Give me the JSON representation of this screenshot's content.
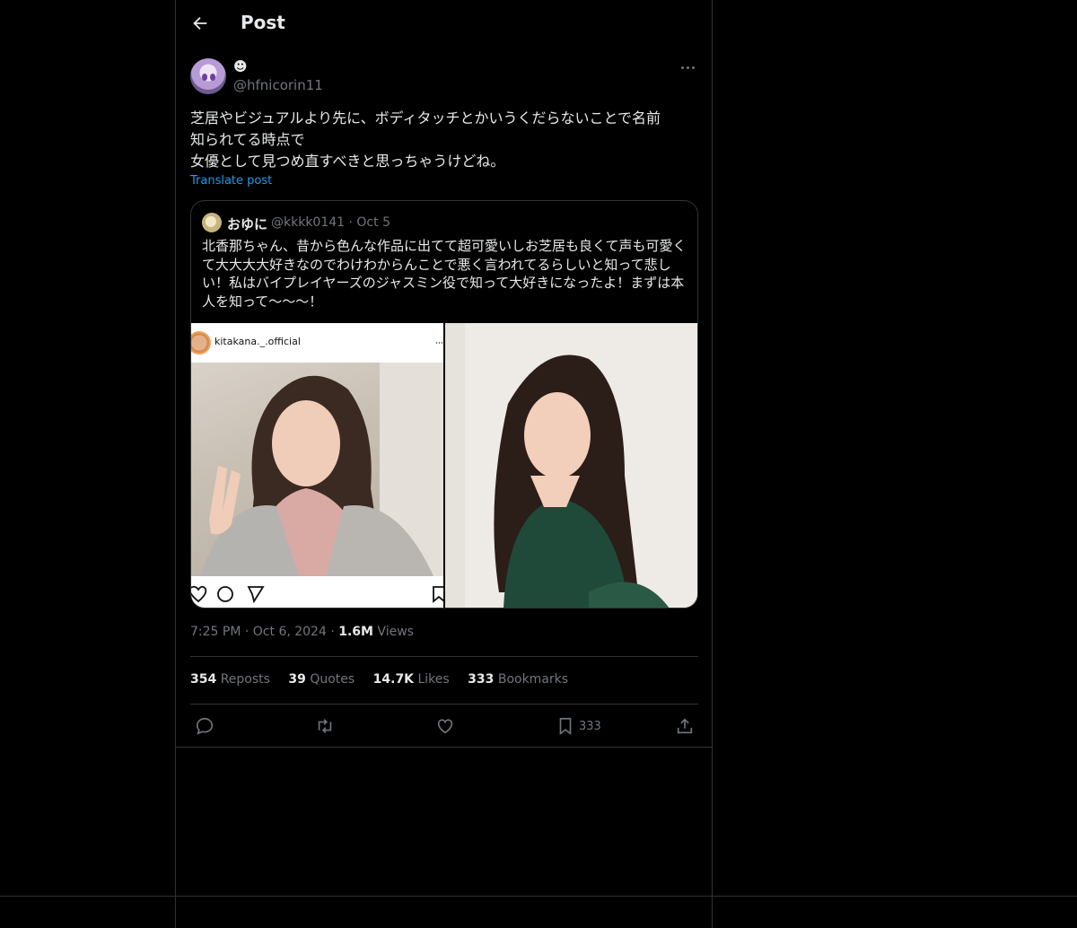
{
  "header": {
    "title": "Post"
  },
  "post": {
    "display_name": "☻",
    "handle": "@hfnicorin11",
    "text_lines": [
      "芝居やビジュアルより先に、ボディタッチとかいうくだらないことで名前",
      "知られてる時点で",
      "女優として見つめ直すべきと思っちゃうけどね。"
    ],
    "translate_label": "Translate post",
    "time": "7:25 PM",
    "date": "Oct 6, 2024",
    "views_count": "1.6M",
    "views_label": "Views"
  },
  "quote": {
    "display_name": "おゆに",
    "handle_line": "@kkkk0141 · Oct 5",
    "text_lines": [
      "北香那ちゃん、昔から色んな作品に出てて超可愛いしお芝居も良くて声も可愛く",
      "て大大大大好きなのでわけわからんことで悪く言われてるらしいと知って悲し",
      "い！私はバイプレイヤーズのジャスミン役で知って大好きになったよ！まずは本",
      "人を知って〜〜〜！"
    ],
    "media_left_account": "kitakana._.official"
  },
  "stats": [
    {
      "count": "354",
      "label": "Reposts"
    },
    {
      "count": "39",
      "label": "Quotes"
    },
    {
      "count": "14.7K",
      "label": "Likes"
    },
    {
      "count": "333",
      "label": "Bookmarks"
    }
  ],
  "actions": {
    "bookmark_count": "333"
  },
  "colors": {
    "background": "#000000",
    "text": "#e7e9ea",
    "muted": "#71767b",
    "link": "#1d9bf0",
    "border": "#2f3336"
  }
}
